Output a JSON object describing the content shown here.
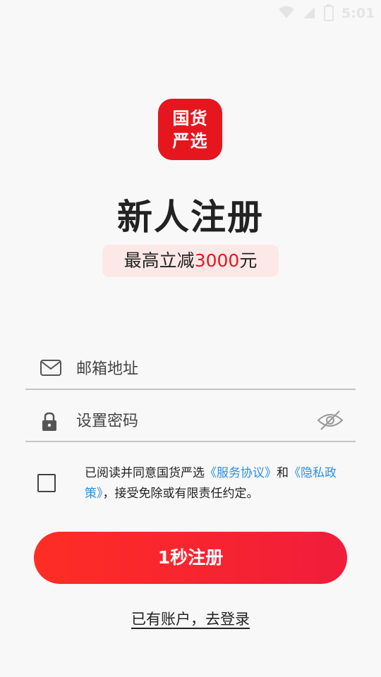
{
  "status_bar": {
    "time": "5:01",
    "icons": [
      "wifi-icon",
      "signal-icon",
      "battery-icon"
    ]
  },
  "logo": {
    "line1": "国货",
    "line2": "严选",
    "color": "#e5161e"
  },
  "title": "新人注册",
  "promo": {
    "prefix": "最高立减",
    "amount": "3000",
    "suffix": "元"
  },
  "form": {
    "email": {
      "placeholder": "邮箱地址",
      "value": "",
      "icon": "mail-icon"
    },
    "password": {
      "placeholder": "设置密码",
      "value": "",
      "icon": "lock-icon",
      "toggle_icon": "eye-hidden-icon"
    }
  },
  "agreement": {
    "checked": false,
    "text_before": "已阅读并同意国货严选",
    "service_link": "《服务协议》",
    "text_and": "和",
    "privacy_link": "《隐私政策》",
    "text_after": "，接受免除或有限责任约定。"
  },
  "register_button": "1秒注册",
  "login_link": "已有账户，去登录",
  "colors": {
    "accent_red": "#e5161e",
    "link_blue": "#2d8ee0",
    "promo_bg": "#fde8e8"
  }
}
